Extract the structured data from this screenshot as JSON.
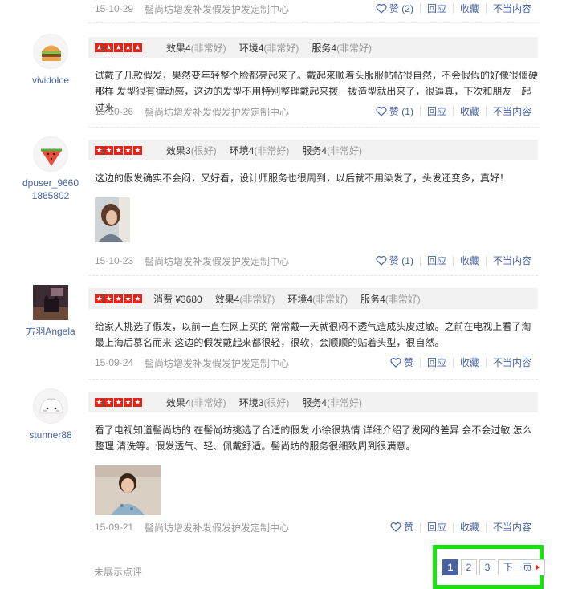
{
  "top_meta": {
    "date": "15-10-29",
    "source": "髻尚坊增发补发假发护发定制中心",
    "like_label": "赞",
    "like_count": "(2)",
    "reply_label": "回应",
    "collect_label": "收藏",
    "report_label": "不当内容"
  },
  "reviews": [
    {
      "username": "vividolce",
      "avatar_icon": "hamburger-avatar",
      "stars": "★★★★★",
      "price": "",
      "effect": "效果4",
      "effect_desc": "(非常好)",
      "env": "环境4",
      "env_desc": "(非常好)",
      "service": "服务4",
      "service_desc": "(非常好)",
      "text": "试戴了几款假发，果然变年轻整个脸都亮起来了。戴起来顺着头服服帖帖很自然，不会假假的好像很僵硬那样 发型很有律动感，这边的发型不用特别整理戴起来拨一拨造型就出来了，很逼真，下次和朋友一起过来",
      "date": "15-10-26",
      "source": "髻尚坊增发补发假发护发定制中心",
      "like_label": "赞",
      "like_count": "(1)",
      "reply_label": "回应",
      "collect_label": "收藏",
      "report_label": "不当内容"
    },
    {
      "username": "dpuser_96601865802",
      "avatar_icon": "watermelon-avatar",
      "stars": "★★★★★",
      "price": "",
      "effect": "效果3",
      "effect_desc": "(很好)",
      "env": "环境4",
      "env_desc": "(非常好)",
      "service": "服务4",
      "service_desc": "(非常好)",
      "text": "这边的假发确实不会闷，又好看，设计师服务也很周到，以后就不用染发了，头发还变多，真好！",
      "date": "15-10-23",
      "source": "髻尚坊增发补发假发护发定制中心",
      "like_label": "赞",
      "like_count": "(1)",
      "reply_label": "回应",
      "collect_label": "收藏",
      "report_label": "不当内容"
    },
    {
      "username": "方羽Angela",
      "avatar_icon": "cat-silhouette-avatar",
      "stars": "★★★★★",
      "price": "消费 ¥3680",
      "effect": "效果4",
      "effect_desc": "(非常好)",
      "env": "环境4",
      "env_desc": "(非常好)",
      "service": "服务4",
      "service_desc": "(非常好)",
      "text": "给家人挑选了假发，以前一直在网上买的 常常戴一天就很闷不透气造成头皮过敏。之前在电视上看了淘最上海后慕名而来 这边的假发戴起来都很轻，很软，会顺顺的贴着头型，很自然。",
      "date": "15-09-24",
      "source": "髻尚坊增发补发假发护发定制中心",
      "like_label": "赞",
      "like_count": "",
      "reply_label": "回应",
      "collect_label": "收藏",
      "report_label": "不当内容"
    },
    {
      "username": "stunner88",
      "avatar_icon": "bun-avatar",
      "stars": "★★★★★",
      "price": "",
      "effect": "效果4",
      "effect_desc": "(非常好)",
      "env": "环境3",
      "env_desc": "(很好)",
      "service": "服务4",
      "service_desc": "(非常好)",
      "text": "看了电视知道髻尚坊的 在髻尚坊挑选了合适的假发 小徐很热情 详细介绍了发网的差异 会不会过敏 怎么整理 清洗等。假发透气、轻、佩戴舒适。髻尚坊的服务很细致周到很满意。",
      "date": "15-09-21",
      "source": "髻尚坊增发补发假发护发定制中心",
      "like_label": "赞",
      "like_count": "",
      "reply_label": "回应",
      "collect_label": "收藏",
      "report_label": "不当内容"
    }
  ],
  "footer": {
    "hidden_reviews": "未展示点评",
    "pages": [
      "1",
      "2",
      "3"
    ],
    "current_page": "1",
    "next_label": "下一页"
  },
  "colors": {
    "link": "#4863a0",
    "star_red": "#e1251b",
    "highlight_green": "#17e10f"
  }
}
